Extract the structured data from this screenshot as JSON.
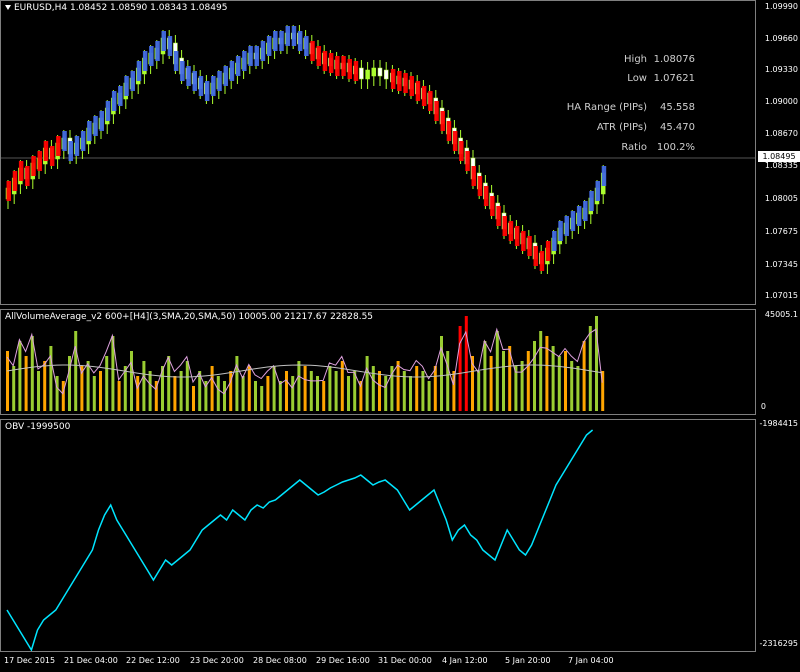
{
  "main": {
    "title": "EURUSD,H4  1.08452 1.08590 1.08343 1.08495",
    "price_labels": [
      "1.09990",
      "1.09660",
      "1.09330",
      "1.09000",
      "1.08670",
      "1.08335",
      "1.08005",
      "1.07675",
      "1.07345",
      "1.07015"
    ],
    "current_price": "1.08495",
    "info": [
      {
        "label": "High",
        "value": "1.08076"
      },
      {
        "label": "Low",
        "value": "1.07621"
      },
      {
        "label": "HA Range (PIPs)",
        "value": "45.558"
      },
      {
        "label": "ATR (PIPs)",
        "value": "45.470"
      },
      {
        "label": "Ratio",
        "value": "100.2%"
      }
    ]
  },
  "volume": {
    "title": "AllVolumeAverage_v2 600+[H4](3,SMA,20,SMA,50) 10005.00 21217.67 22828.55",
    "max_label": "45005.1",
    "min_label": "0"
  },
  "obv": {
    "title": "OBV -1999500",
    "max_label": "-1984415",
    "min_label": "-2316295"
  },
  "time_labels": [
    "17 Dec 2015",
    "21 Dec 04:00",
    "22 Dec 12:00",
    "23 Dec 20:00",
    "28 Dec 08:00",
    "29 Dec 16:00",
    "31 Dec 00:00",
    "4 Jan 12:00",
    "5 Jan 20:00",
    "7 Jan 04:00"
  ],
  "colors": {
    "bull": "#adff2f",
    "bear": "#ffffff",
    "ha_up": "#4169e1",
    "ha_down": "#ff0000",
    "obv": "#00e5ff",
    "vol_orange": "#ffa500",
    "vol_green": "#9acd32",
    "vol_red": "#ff0000"
  }
}
